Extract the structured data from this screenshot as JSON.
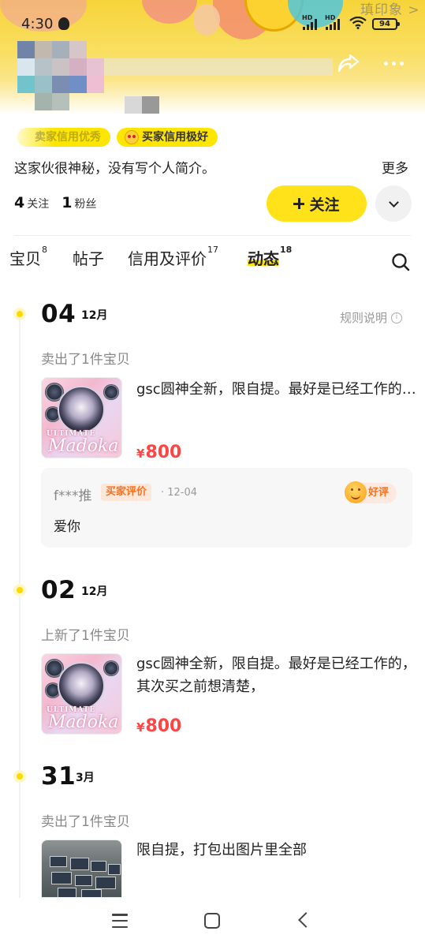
{
  "status_bar": {
    "time": "4:30",
    "battery": "94",
    "network_label_1": "HD",
    "network_label_2": "HD",
    "watermark": "瑱印象 >"
  },
  "header": {
    "share_icon": "share-icon",
    "more_icon": "more-icon"
  },
  "profile": {
    "badges": [
      {
        "label": "卖家信用优秀"
      },
      {
        "label": "买家信用极好"
      }
    ],
    "bio": "这家伙很神秘，没有写个人简介。",
    "bio_more": "更多",
    "stats": [
      {
        "num": "4",
        "label": "关注"
      },
      {
        "num": "1",
        "label": "粉丝"
      }
    ],
    "follow_label": "关注"
  },
  "tabs": [
    {
      "label": "宝贝",
      "count": "8"
    },
    {
      "label": "帖子",
      "count": ""
    },
    {
      "label": "信用及评价",
      "count": "17"
    },
    {
      "label": "动态",
      "count": "18",
      "active": true
    }
  ],
  "timeline": {
    "rules_label": "规则说明",
    "events": [
      {
        "day": "04",
        "month": "12月",
        "label": "卖出了1件宝贝",
        "item_title": "gsc圆神全新，限自提。最好是已经工作的，其次买之前想清楚，",
        "price": "800",
        "currency": "¥",
        "thumb_text_1": "ULTIMATE",
        "thumb_text_2": "Madoka",
        "review": {
          "reviewer": "f***推",
          "tag": "买家评价",
          "date": "· 12-04",
          "rating": "好评",
          "text": "爱你"
        }
      },
      {
        "day": "02",
        "month": "12月",
        "label": "上新了1件宝贝",
        "item_title": "gsc圆神全新，限自提。最好是已经工作的，其次买之前想清楚，",
        "price": "800",
        "currency": "¥",
        "thumb_text_1": "ULTIMATE",
        "thumb_text_2": "Madoka"
      },
      {
        "day": "31",
        "month": "3月",
        "label": "卖出了1件宝贝",
        "item_title": "限自提，打包出图片里全部"
      }
    ]
  },
  "colors": {
    "accent": "#ffe219",
    "price": "#ff4444",
    "review_tag": "#ff6f1a"
  }
}
